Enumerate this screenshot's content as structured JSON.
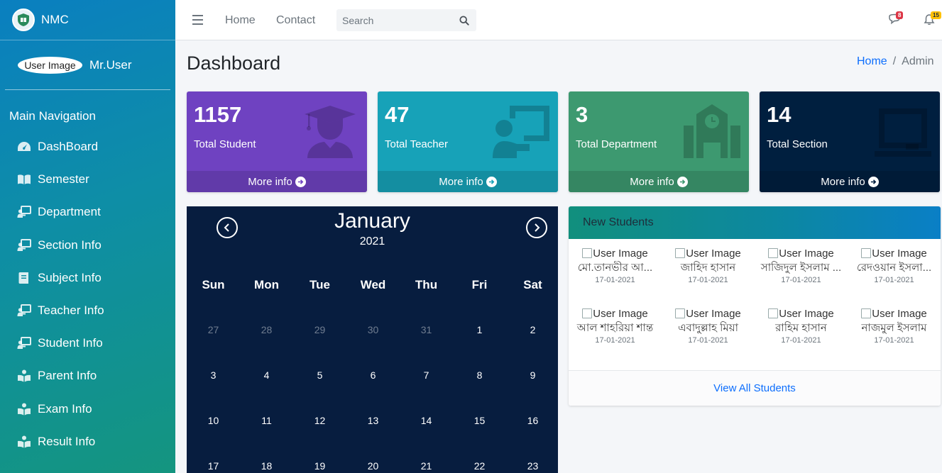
{
  "brand": {
    "name": "NMC",
    "logo": "college-crest-logo"
  },
  "user": {
    "image_alt": "User Image",
    "name": "Mr.User"
  },
  "sidebar": {
    "header": "Main Navigation",
    "items": [
      {
        "label": "DashBoard",
        "icon": "tachometer-icon"
      },
      {
        "label": "Semester",
        "icon": "book-open-icon"
      },
      {
        "label": "Department",
        "icon": "chalkboard-teacher-icon"
      },
      {
        "label": "Section Info",
        "icon": "chalkboard-teacher-icon"
      },
      {
        "label": "Subject Info",
        "icon": "book-icon"
      },
      {
        "label": "Teacher Info",
        "icon": "chalkboard-teacher-icon"
      },
      {
        "label": "Student Info",
        "icon": "chalkboard-teacher-icon"
      },
      {
        "label": "Parent Info",
        "icon": "book-reader-icon"
      },
      {
        "label": "Exam Info",
        "icon": "book-reader-icon"
      },
      {
        "label": "Result Info",
        "icon": "book-reader-icon"
      }
    ]
  },
  "topbar": {
    "links": [
      "Home",
      "Contact"
    ],
    "search_placeholder": "Search",
    "messages_badge": "8",
    "notifications_badge": "15"
  },
  "page": {
    "title": "Dashboard",
    "breadcrumb": [
      "Home",
      "Admin"
    ]
  },
  "stats": [
    {
      "value": "1157",
      "label": "Total Student",
      "more": "More info",
      "color": "#6f42c1",
      "icon": "graduate-icon"
    },
    {
      "value": "47",
      "label": "Total Teacher",
      "more": "More info",
      "color": "#17a2b8",
      "icon": "chalkboard-teacher-icon"
    },
    {
      "value": "3",
      "label": "Total Department",
      "more": "More info",
      "color": "#3d9970",
      "icon": "school-icon"
    },
    {
      "value": "14",
      "label": "Total Section",
      "more": "More info",
      "color": "#001f3f",
      "icon": "chalkboard-icon"
    }
  ],
  "calendar": {
    "month": "January",
    "year": "2021",
    "weekdays": [
      "Sun",
      "Mon",
      "Tue",
      "Wed",
      "Thu",
      "Fri",
      "Sat"
    ],
    "weeks": [
      [
        "27",
        "28",
        "29",
        "30",
        "31",
        "1",
        "2"
      ],
      [
        "3",
        "4",
        "5",
        "6",
        "7",
        "8",
        "9"
      ],
      [
        "10",
        "11",
        "12",
        "13",
        "14",
        "15",
        "16"
      ],
      [
        "17",
        "18",
        "19",
        "20",
        "21",
        "22",
        "23"
      ]
    ],
    "muted_first_week_count": 5
  },
  "new_students": {
    "title": "New Students",
    "image_alt": "User Image",
    "students": [
      {
        "name": "মো.তানভীর আ...",
        "date": "17-01-2021"
      },
      {
        "name": "জাহিদ হাসান",
        "date": "17-01-2021"
      },
      {
        "name": "সাজিদুল ইসলাম ...",
        "date": "17-01-2021"
      },
      {
        "name": "রেদওয়ান ইসলা...",
        "date": "17-01-2021"
      },
      {
        "name": "আল শাহরিয়া শান্ত",
        "date": "17-01-2021"
      },
      {
        "name": "এবাদুল্লাহ মিয়া",
        "date": "17-01-2021"
      },
      {
        "name": "রাহিম হাসান",
        "date": "17-01-2021"
      },
      {
        "name": "নাজমুল ইসলাম",
        "date": "17-01-2021"
      }
    ],
    "footer_link": "View All Students"
  }
}
